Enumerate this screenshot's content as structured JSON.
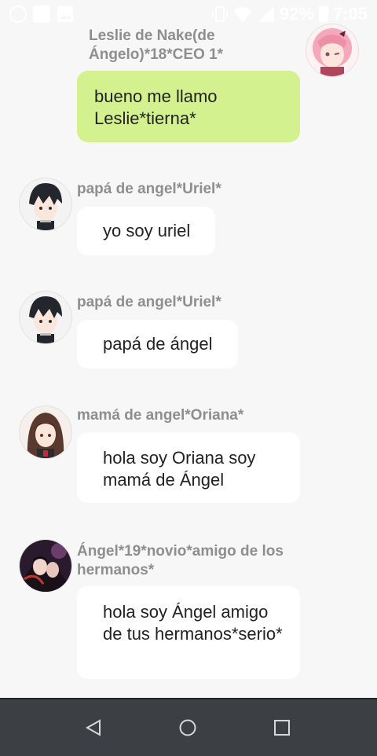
{
  "status_bar": {
    "battery": "92%",
    "time": "7:05",
    "icons": [
      "whatsapp-icon",
      "notification-icon",
      "image-icon",
      "vibrate-icon",
      "wifi-icon",
      "signal-icon",
      "battery-icon"
    ]
  },
  "messages": [
    {
      "sender": "Leslie de Nake(de Ángelo)*18*CEO 1*",
      "text": "bueno me llamo Leslie*tierna*",
      "mine": true,
      "avatar": "pink-hair-anime-girl-avatar"
    },
    {
      "sender": "papá de angel*Uriel*",
      "text": "yo soy uriel",
      "mine": false,
      "avatar": "dark-hair-anime-boy-avatar"
    },
    {
      "sender": "papá de angel*Uriel*",
      "text": "papá de ángel",
      "mine": false,
      "avatar": "dark-hair-anime-boy-avatar"
    },
    {
      "sender": "mamá de angel*Oriana*",
      "text": "hola soy Oriana soy mamá de Ángel",
      "mine": false,
      "avatar": "brown-hair-anime-girl-avatar"
    },
    {
      "sender": "Ángel*19*novio*amigo de los hermanos*",
      "text": "hola soy Ángel amigo de tus hermanos*serio*",
      "mine": false,
      "avatar": "dark-anime-couple-avatar"
    }
  ],
  "colors": {
    "background": "#f7f7f7",
    "my_bubble": "#d4f18f",
    "other_bubble": "#ffffff",
    "sender_name": "#8e8e8e",
    "nav_bar": "#3c3f44"
  },
  "nav_bar": {
    "buttons": [
      "back-icon",
      "home-icon",
      "recents-icon"
    ]
  }
}
